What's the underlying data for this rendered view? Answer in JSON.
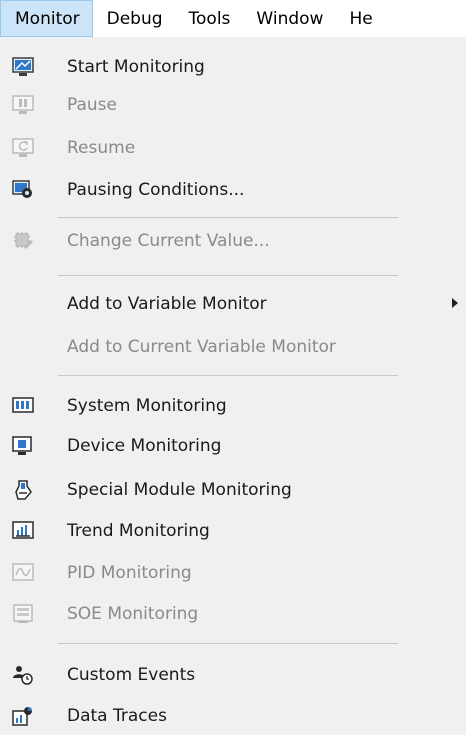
{
  "menubar": {
    "items": [
      {
        "label": "Monitor"
      },
      {
        "label": "Debug"
      },
      {
        "label": "Tools"
      },
      {
        "label": "Window"
      },
      {
        "label": "He"
      }
    ]
  },
  "menu": {
    "start_monitoring": {
      "label": "Start Monitoring",
      "icon": "start-monitoring-icon"
    },
    "pause": {
      "label": "Pause",
      "icon": "pause-icon"
    },
    "resume": {
      "label": "Resume",
      "icon": "resume-icon"
    },
    "pausing_conditions": {
      "label": "Pausing Conditions...",
      "icon": "pausing-conditions-icon"
    },
    "change_current_value": {
      "label": "Change Current Value...",
      "icon": "change-value-icon"
    },
    "add_to_variable_monitor": {
      "label": "Add to Variable Monitor"
    },
    "add_to_current_variable_monitor": {
      "label": "Add to Current Variable Monitor"
    },
    "system_monitoring": {
      "label": "System Monitoring",
      "icon": "system-monitoring-icon"
    },
    "device_monitoring": {
      "label": "Device Monitoring",
      "icon": "device-monitoring-icon"
    },
    "special_module_monitoring": {
      "label": "Special Module Monitoring",
      "icon": "special-module-icon"
    },
    "trend_monitoring": {
      "label": "Trend Monitoring",
      "icon": "trend-monitoring-icon"
    },
    "pid_monitoring": {
      "label": "PID Monitoring",
      "icon": "pid-monitoring-icon"
    },
    "soe_monitoring": {
      "label": "SOE Monitoring",
      "icon": "soe-monitoring-icon"
    },
    "custom_events": {
      "label": "Custom Events",
      "icon": "custom-events-icon"
    },
    "data_traces": {
      "label": "Data Traces",
      "icon": "data-traces-icon"
    }
  },
  "colors": {
    "menu_bg": "#f0f0f0",
    "active_menubar_bg": "#cce4f7",
    "disabled_text": "#8a8a8a"
  }
}
